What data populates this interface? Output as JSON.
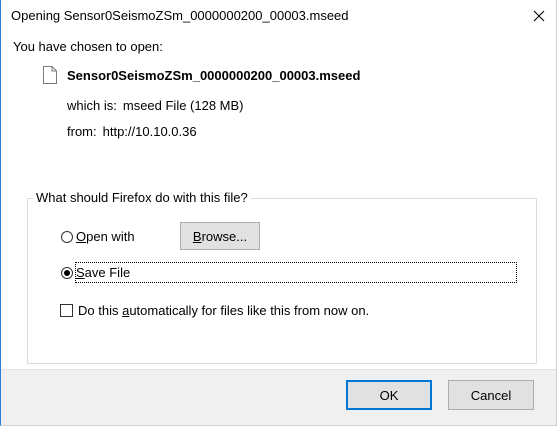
{
  "window": {
    "title": "Opening Sensor0SeismoZSm_0000000200_00003.mseed",
    "close_glyph": "✕"
  },
  "info": {
    "chosen_label": "You have chosen to open:",
    "file_name": "Sensor0SeismoZSm_0000000200_00003.mseed",
    "which_is_label": "which is:",
    "which_is_value": "mseed File (128 MB)",
    "from_label": "from:",
    "from_value": "http://10.10.0.36"
  },
  "action_group": {
    "legend": "What should Firefox do with this file?",
    "open_with": {
      "mnemonic": "O",
      "rest": "pen with",
      "selected": false
    },
    "browse": {
      "mnemonic": "B",
      "rest": "rowse..."
    },
    "save_file": {
      "mnemonic": "S",
      "rest": "ave File",
      "selected": true
    },
    "auto_checkbox": {
      "before": "Do this ",
      "mnemonic": "a",
      "after": "utomatically for files like this from now on.",
      "checked": false
    }
  },
  "buttons": {
    "ok": "OK",
    "cancel": "Cancel"
  },
  "colors": {
    "window_border": "#2f7fd8",
    "default_button_border": "#0078d7",
    "button_face": "#e1e1e1",
    "footer_bg": "#f0f0f0"
  },
  "icons": {
    "file": "document-icon",
    "close": "close-icon"
  }
}
